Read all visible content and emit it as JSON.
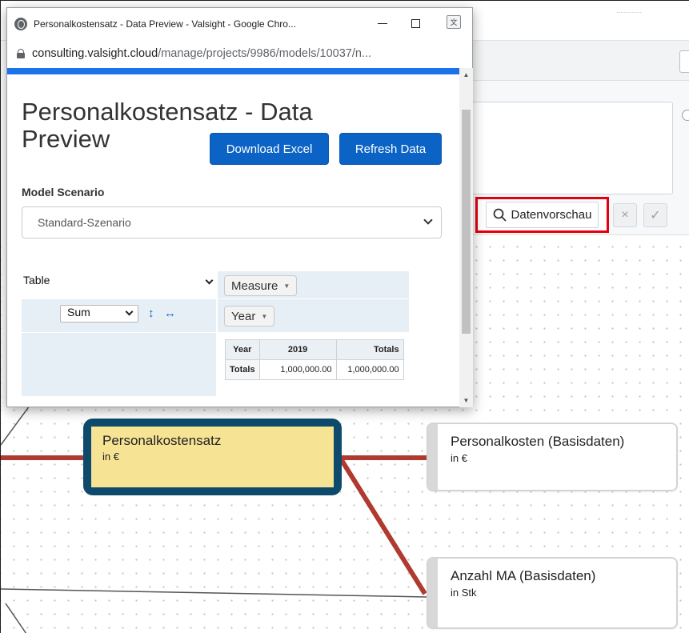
{
  "background": {
    "preview_button_label": "Datenvorschau",
    "cancel_icon": "×",
    "confirm_icon": "✓",
    "nodes": [
      {
        "title": "Personalkostensatz",
        "unit": "in €"
      },
      {
        "title": "Personalkosten (Basisdaten)",
        "unit": "in €"
      },
      {
        "title": "Anzahl MA (Basisdaten)",
        "unit": "in Stk"
      }
    ],
    "colors": {
      "edge": "#b03a2e",
      "selected_node_border": "#0e4a6b",
      "selected_node_fill": "#f7e394",
      "highlight": "#e3000f"
    }
  },
  "popup": {
    "window_title": "Personalkostensatz - Data Preview - Valsight - Google Chro...",
    "url_host": "consulting.valsight.cloud",
    "url_path": "/manage/projects/9986/models/10037/n...",
    "page_title": "Personalkostensatz - Data Preview",
    "buttons": {
      "download": "Download Excel",
      "refresh": "Refresh Data"
    },
    "scenario_label": "Model Scenario",
    "scenario_value": "Standard-Szenario",
    "pivot": {
      "renderer": "Table",
      "aggregator": "Sum",
      "measure_pill": "Measure",
      "year_pill": "Year",
      "table": {
        "header": [
          "Year",
          "2019",
          "Totals"
        ],
        "row": [
          "Totals",
          "1,000,000.00",
          "1,000,000.00"
        ]
      }
    },
    "colors": {
      "accent": "#1a73e8",
      "button": "#0b63c5",
      "pivot_bg": "#e6eef6"
    }
  }
}
